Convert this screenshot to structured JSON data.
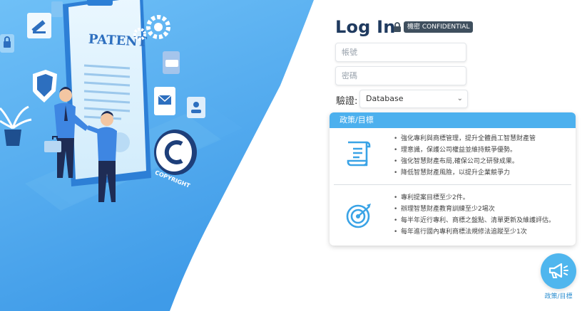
{
  "login": {
    "title": "Log In",
    "confidential_badge": "機密 CONFIDENTIAL",
    "username_placeholder": "帳號",
    "password_placeholder": "密碼",
    "verify_label": "驗證:",
    "verify_selected": "Database"
  },
  "illustration": {
    "patent_text": "PATENT",
    "copyright_text": "COPYRIGHT"
  },
  "policy": {
    "header": "政策/目標",
    "section1_items": [
      "強化專利與商標管理，提升全體員工智慧財產管",
      "理意識，保護公司權益並維持競爭優勢。",
      "強化智慧財產布局,確保公司之研發成果。",
      "降低智慧財產風險，以提升企業競爭力"
    ],
    "section2_items": [
      "專利提案目標至少2件。",
      "辦理智慧財產教育訓練至少2場次",
      "每半年近行專利、商標之盤點、清單更新及維護評估。",
      "每年進行國內專利商標法規修法追蹤至少1次"
    ]
  },
  "fab": {
    "label": "政策/目標"
  },
  "colors": {
    "panel_blue": "#4ba7ee",
    "header_blue": "#4cb0ee",
    "title_navy": "#1f3a5f",
    "badge_gray": "#3f4f5e"
  }
}
